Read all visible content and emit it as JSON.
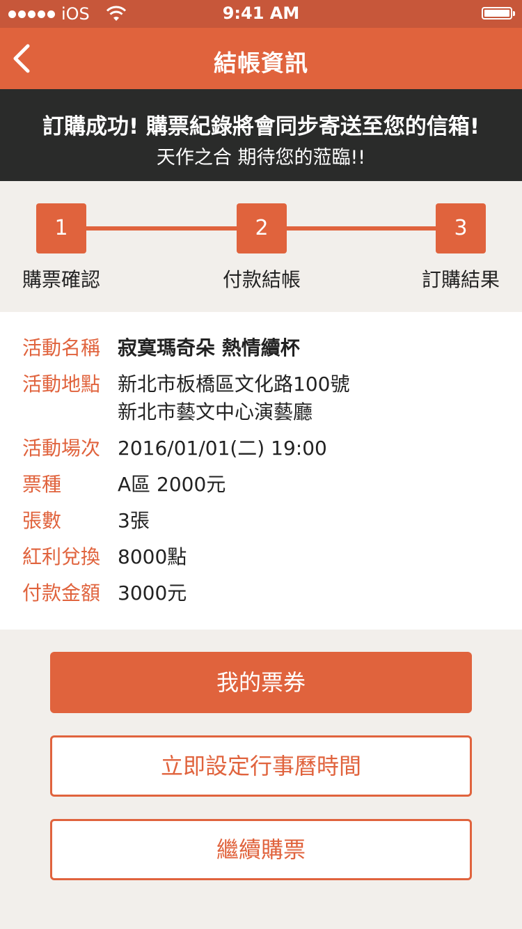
{
  "status_bar": {
    "carrier": "iOS",
    "time": "9:41 AM",
    "signal_dots": 5
  },
  "nav": {
    "title": "結帳資訊",
    "back_icon": "chevron-left-icon"
  },
  "banner": {
    "line1": "訂購成功! 購票紀錄將會同步寄送至您的信箱!",
    "line2": "天作之合 期待您的蒞臨!!"
  },
  "steps": [
    {
      "number": "1",
      "label": "購票確認"
    },
    {
      "number": "2",
      "label": "付款結帳"
    },
    {
      "number": "3",
      "label": "訂購結果"
    }
  ],
  "details": {
    "event_name": {
      "label": "活動名稱",
      "value": "寂寞瑪奇朵  熱情續杯"
    },
    "venue": {
      "label": "活動地點",
      "line1": "新北市板橋區文化路100號",
      "line2": "新北市藝文中心演藝廳"
    },
    "session": {
      "label": "活動場次",
      "value": "2016/01/01(二) 19:00"
    },
    "ticket_type": {
      "label": "票種",
      "value": "A區  2000元"
    },
    "quantity": {
      "label": "張數",
      "value": "3張"
    },
    "bonus": {
      "label": "紅利兌換",
      "value": "8000點"
    },
    "amount": {
      "label": "付款金額",
      "value": "3000元"
    }
  },
  "buttons": {
    "my_tickets": "我的票券",
    "set_calendar": "立即設定行事曆時間",
    "continue": "繼續購票"
  },
  "colors": {
    "accent": "#e0633d",
    "status_bar": "#c7573a",
    "banner_bg": "#2a2b2a",
    "page_bg": "#f2efeb"
  }
}
